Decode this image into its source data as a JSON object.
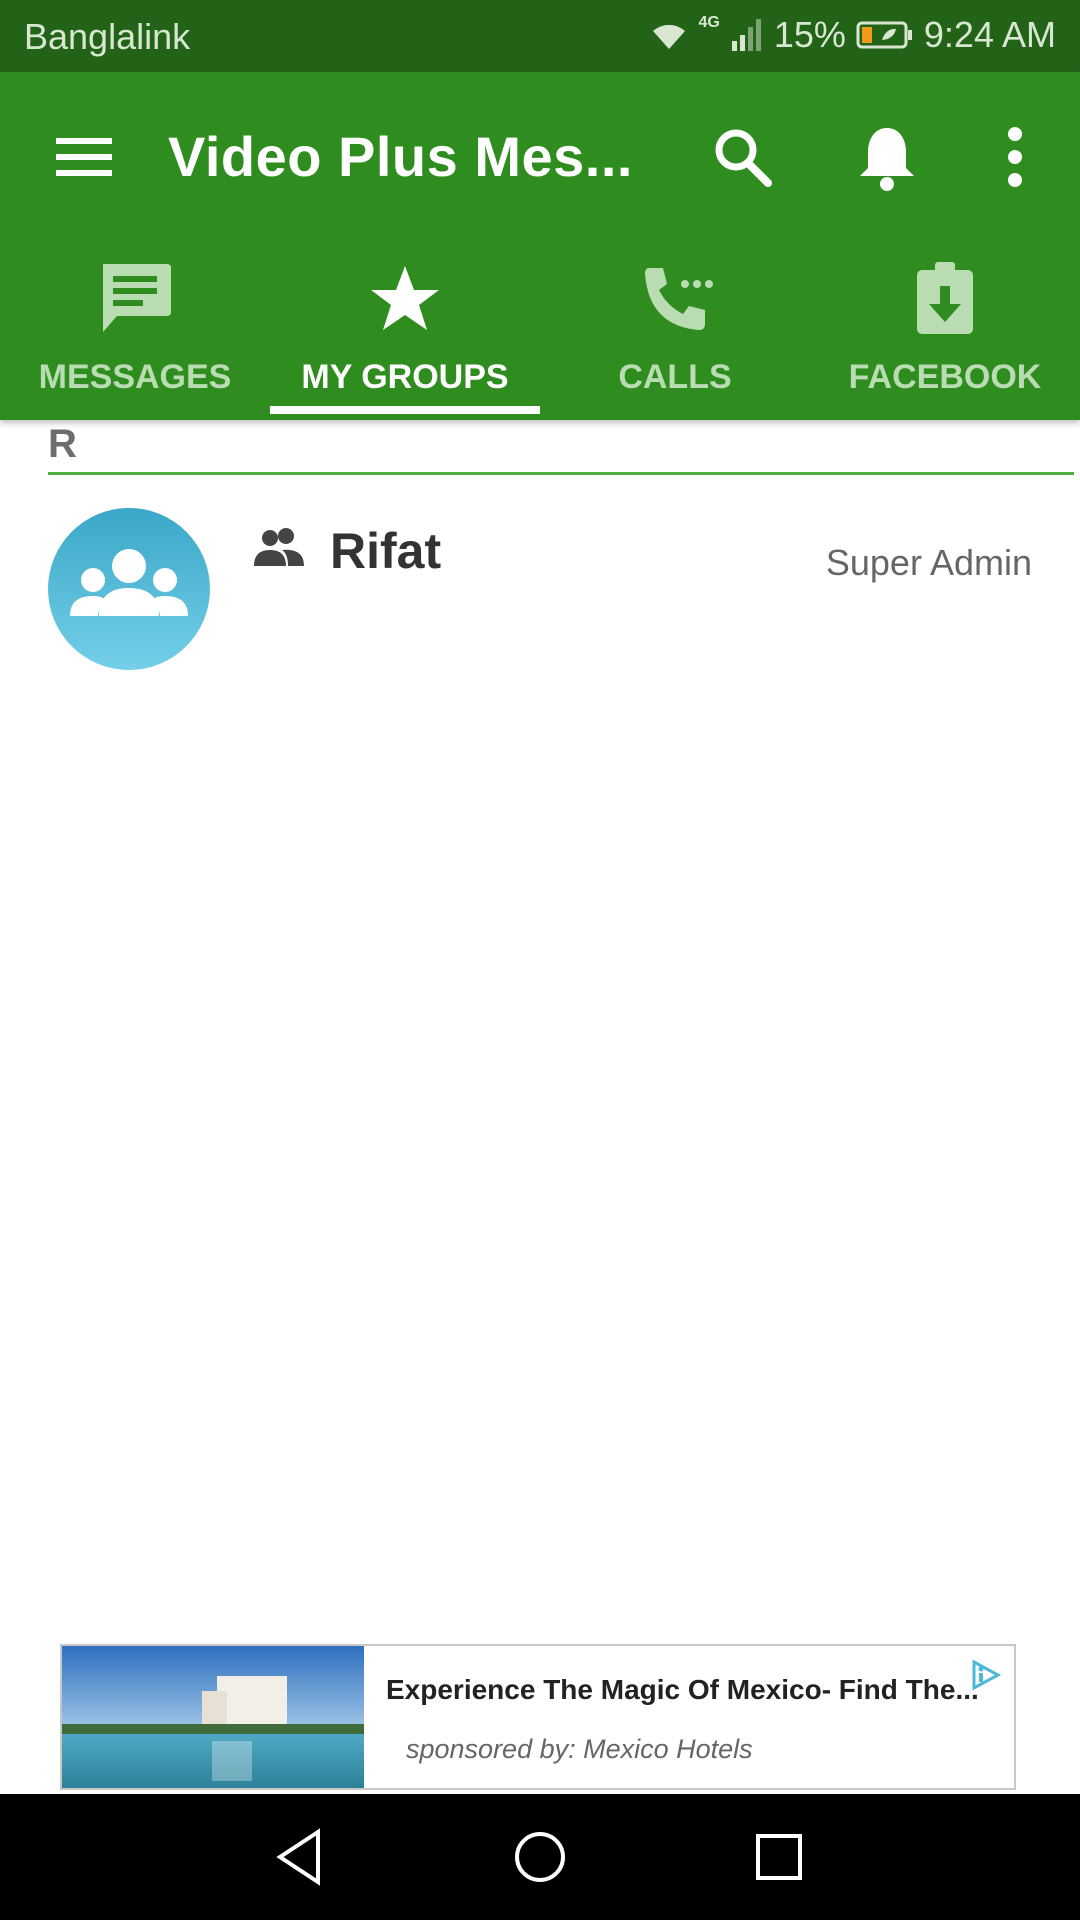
{
  "status_bar": {
    "carrier": "Banglalink",
    "network": "4G",
    "battery": "15%",
    "time": "9:24 AM",
    "icons": [
      "wifi-icon",
      "signal-icon",
      "battery-icon"
    ]
  },
  "app_bar": {
    "title": "Video Plus Mes...",
    "actions": [
      "menu-icon",
      "search-icon",
      "bell-icon",
      "more-vert-icon"
    ]
  },
  "tabs": [
    {
      "label": "MESSAGES",
      "icon": "message-icon",
      "active": false
    },
    {
      "label": "MY GROUPS",
      "icon": "star-icon",
      "active": true
    },
    {
      "label": "CALLS",
      "icon": "phone-icon",
      "active": false
    },
    {
      "label": "FACEBOOK",
      "icon": "clipboard-download-icon",
      "active": false
    }
  ],
  "list": {
    "section_letter": "R",
    "groups": [
      {
        "name": "Rifat",
        "role": "Super Admin",
        "icon": "group-icon"
      }
    ]
  },
  "ad": {
    "title": "Experience The Magic Of Mexico- Find The...",
    "sponsor": "sponsored by: Mexico Hotels",
    "icon": "ad-choices-icon"
  },
  "colors": {
    "app_bar": "#2f8c1e",
    "status_bar": "#236318",
    "avatar": "#4fb8d6",
    "divider": "#4caf3f"
  }
}
